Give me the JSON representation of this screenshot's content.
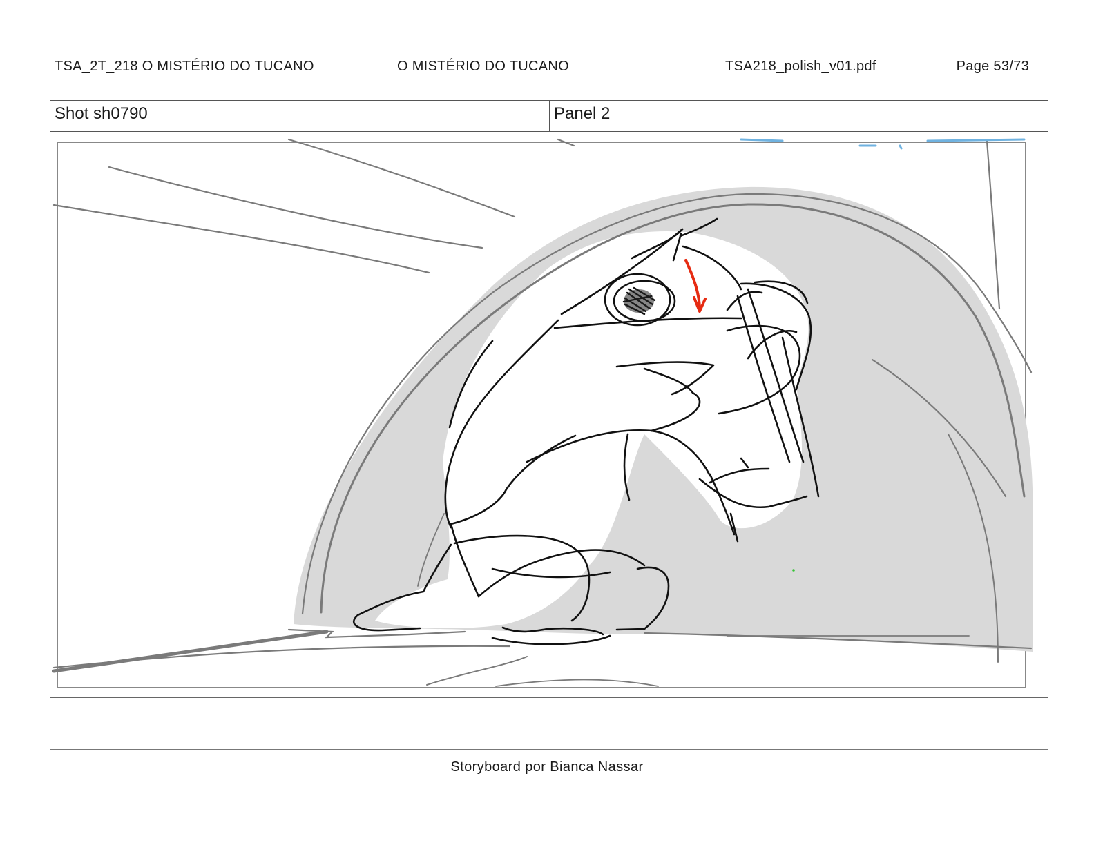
{
  "header": {
    "project_code": "TSA_2T_218  O MISTÉRIO DO TUCANO",
    "episode_title": "O MISTÉRIO DO TUCANO",
    "file_name": "TSA218_polish_v01.pdf",
    "page": "Page 53/73"
  },
  "info": {
    "shot": "Shot sh0790",
    "panel": "Panel 2"
  },
  "notes": {
    "text": ""
  },
  "footer": {
    "credit": "Storyboard por Bianca Nassar"
  },
  "colors": {
    "line": "#111111",
    "rough_line": "#7a7a7a",
    "shadow_fill": "#d9d9d9",
    "direction_arrow": "#e62b12",
    "blue_marks": "#6fb2e0"
  }
}
